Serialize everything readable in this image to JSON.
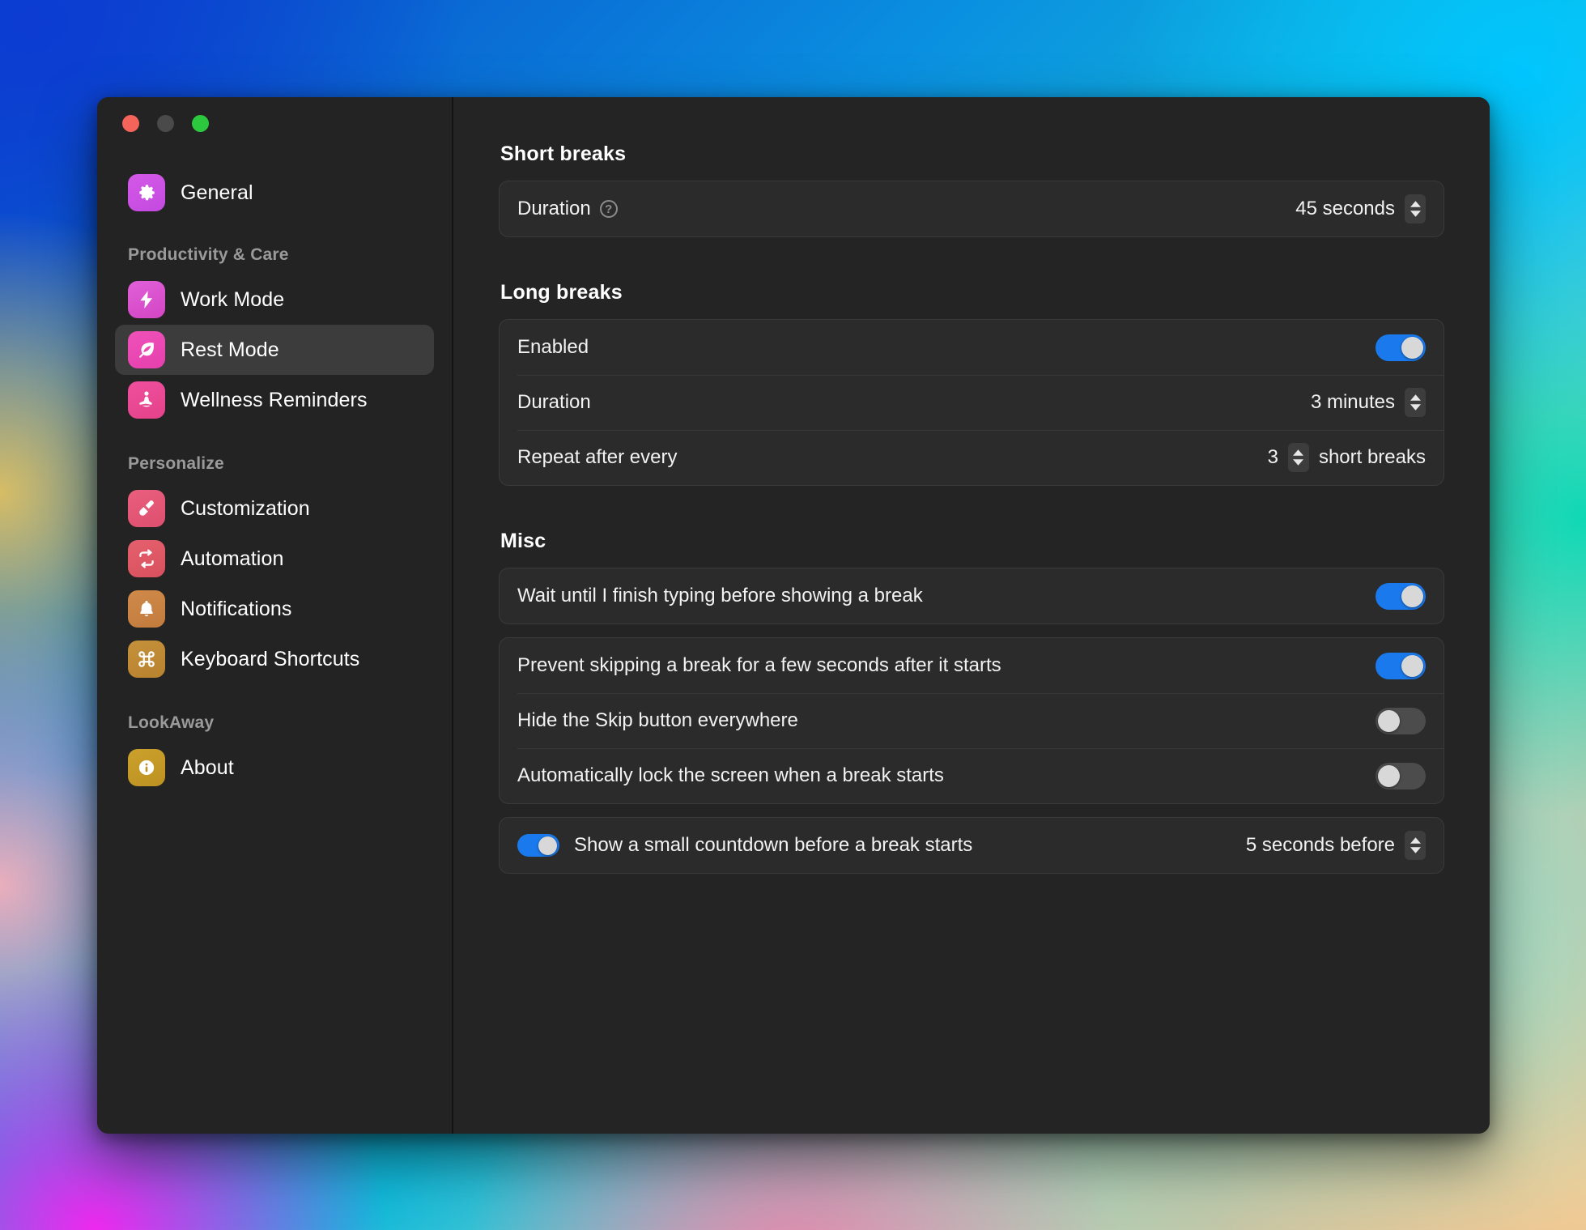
{
  "window": {
    "traffic_lights": [
      "close",
      "minimize",
      "zoom"
    ]
  },
  "sidebar": {
    "top_items": [
      {
        "label": "General",
        "icon": "gear-icon"
      }
    ],
    "sections": [
      {
        "title": "Productivity & Care",
        "items": [
          {
            "label": "Work Mode",
            "icon": "bolt-icon",
            "selected": false
          },
          {
            "label": "Rest Mode",
            "icon": "leaf-icon",
            "selected": true
          },
          {
            "label": "Wellness Reminders",
            "icon": "meditation-icon",
            "selected": false
          }
        ]
      },
      {
        "title": "Personalize",
        "items": [
          {
            "label": "Customization",
            "icon": "paintbrush-icon",
            "selected": false
          },
          {
            "label": "Automation",
            "icon": "repeat-icon",
            "selected": false
          },
          {
            "label": "Notifications",
            "icon": "bell-icon",
            "selected": false
          },
          {
            "label": "Keyboard Shortcuts",
            "icon": "command-icon",
            "selected": false
          }
        ]
      },
      {
        "title": "LookAway",
        "items": [
          {
            "label": "About",
            "icon": "info-icon",
            "selected": false
          }
        ]
      }
    ]
  },
  "main": {
    "short_breaks": {
      "title": "Short breaks",
      "duration": {
        "label": "Duration",
        "help_glyph": "?",
        "value": "45 seconds"
      }
    },
    "long_breaks": {
      "title": "Long breaks",
      "enabled": {
        "label": "Enabled",
        "state": "on"
      },
      "duration": {
        "label": "Duration",
        "value": "3 minutes"
      },
      "repeat": {
        "label": "Repeat after every",
        "value": "3",
        "suffix": "short breaks"
      }
    },
    "misc": {
      "title": "Misc",
      "wait_typing": {
        "label": "Wait until I finish typing before showing a break",
        "state": "on"
      },
      "prevent_skip": {
        "label": "Prevent skipping a break for a few seconds after it starts",
        "state": "on"
      },
      "hide_skip": {
        "label": "Hide the Skip button everywhere",
        "state": "off"
      },
      "auto_lock": {
        "label": "Automatically lock the screen when a break starts",
        "state": "off"
      },
      "countdown": {
        "label": "Show a small countdown before a break starts",
        "state": "on",
        "value": "5 seconds before"
      }
    }
  },
  "colors": {
    "accent_blue": "#1a7aed",
    "window_bg": "#242424",
    "sidebar_bg": "#232323",
    "card_bg": "#2b2b2b",
    "selected_bg": "#3c3c3c"
  }
}
